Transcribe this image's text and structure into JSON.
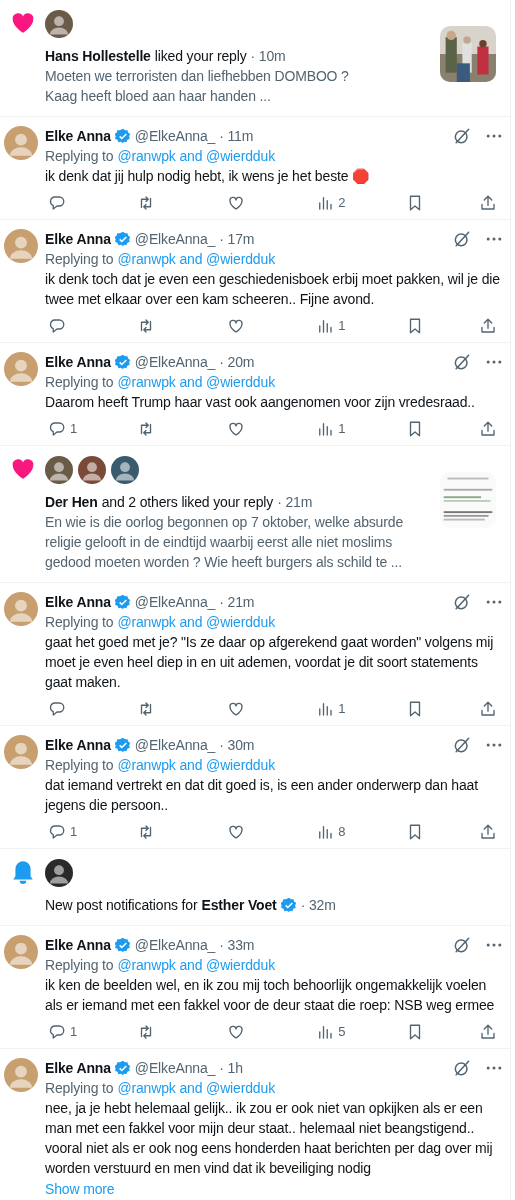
{
  "notifications": [
    {
      "kind": "like",
      "actor": "Hans Hollestelle",
      "action": "liked your reply",
      "time": "· 10m",
      "excerpt": "Moeten we terroristen dan liefhebben DOMBOO ?\nKaag heeft bloed aan haar handen ..."
    },
    {
      "kind": "reply",
      "name": "Elke Anna",
      "verified": true,
      "handle": "@ElkeAnna_",
      "time": "· 11m",
      "replying_label": "Replying to",
      "replying_to": "@ranwpk and @wierdduk",
      "text": "ik denk dat jij hulp nodig hebt, ik wens je het beste 🛑",
      "views": "2"
    },
    {
      "kind": "reply",
      "name": "Elke Anna",
      "verified": true,
      "handle": "@ElkeAnna_",
      "time": "· 17m",
      "replying_label": "Replying to",
      "replying_to": "@ranwpk and @wierdduk",
      "text": "ik denk toch dat je even een geschiedenisboek erbij moet pakken, wil je die twee met elkaar over een kam scheeren.. Fijne avond.",
      "views": "1"
    },
    {
      "kind": "reply",
      "name": "Elke Anna",
      "verified": true,
      "handle": "@ElkeAnna_",
      "time": "· 20m",
      "replying_label": "Replying to",
      "replying_to": "@ranwpk and @wierdduk",
      "text": "Daarom heeft Trump haar vast ook aangenomen voor zijn vredesraad..",
      "replies": "1",
      "views": "1"
    },
    {
      "kind": "like",
      "actor": "Der Hen",
      "action": "and 2 others liked your reply",
      "time": "· 21m",
      "excerpt": "En wie is die oorlog begonnen op 7 oktober, welke absurde religie gelooft in de eindtijd waarbij eerst  alle niet moslims gedood moeten worden ? Wie heeft burgers als schild te ...",
      "thumbnail": {
        "kind": "document"
      }
    },
    {
      "kind": "reply",
      "name": "Elke Anna",
      "verified": true,
      "handle": "@ElkeAnna_",
      "time": "· 21m",
      "replying_label": "Replying to",
      "replying_to": "@ranwpk and @wierdduk",
      "text": "gaat het goed met je? \"Is ze daar op afgerekend gaat worden\" volgens mij moet je even heel diep in en uit ademen, voordat je dit soort statements gaat maken.",
      "views": "1"
    },
    {
      "kind": "reply",
      "name": "Elke Anna",
      "verified": true,
      "handle": "@ElkeAnna_",
      "time": "· 30m",
      "replying_label": "Replying to",
      "replying_to": "@ranwpk and @wierdduk",
      "text": "dat iemand vertrekt en dat dit goed is, is een ander onderwerp dan haat jegens die persoon..",
      "replies": "1",
      "views": "8"
    },
    {
      "kind": "bell",
      "text": "New post notifications for",
      "actor": "Esther Voet",
      "verified": true,
      "time": "· 32m"
    },
    {
      "kind": "reply",
      "name": "Elke Anna",
      "verified": true,
      "handle": "@ElkeAnna_",
      "time": "· 33m",
      "replying_label": "Replying to",
      "replying_to": "@ranwpk and @wierdduk",
      "text": "ik ken de beelden wel, en ik zou mij toch behoorlijk ongemakkelijk voelen als er iemand met een fakkel voor de deur staat die roep: NSB weg ermee",
      "replies": "1",
      "views": "5"
    },
    {
      "kind": "reply",
      "name": "Elke Anna",
      "verified": true,
      "handle": "@ElkeAnna_",
      "time": "· 1h",
      "replying_label": "Replying to",
      "replying_to": "@ranwpk and @wierdduk",
      "text": "nee, ja je hebt helemaal gelijk.. ik zou er ook niet van opkijken als er een man met een fakkel voor mijn deur staat.. helemaal niet beangstigend.. vooral niet als er ook nog eens honderden haat berichten per dag over mij worden verstuurd en men vind dat ik beveiliging nodig",
      "show_more": "Show more"
    }
  ]
}
